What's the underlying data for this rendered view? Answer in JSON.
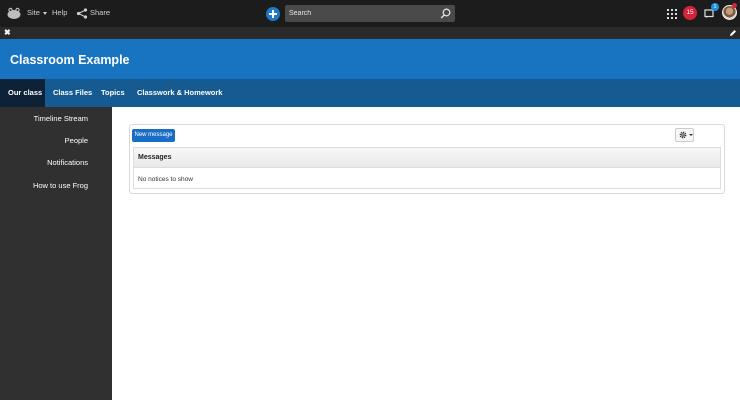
{
  "topbar": {
    "site_label": "Site",
    "help_label": "Help",
    "share_label": "Share",
    "search_placeholder": "Search",
    "notification_count": "15",
    "message_count": "1",
    "accent_color": "#1f78c8",
    "badge_color": "#d2233a"
  },
  "header": {
    "title": "Classroom Example",
    "color": "#1874c1"
  },
  "tabs": [
    {
      "label": "Our class",
      "active": true
    },
    {
      "label": "Class Files",
      "active": false
    },
    {
      "label": "Topics",
      "active": false
    },
    {
      "label": "Classwork & Homework",
      "active": false
    }
  ],
  "sidebar": {
    "items": [
      {
        "label": "Timeline Stream"
      },
      {
        "label": "People"
      },
      {
        "label": "Notifications"
      },
      {
        "label": "How to use Frog"
      }
    ]
  },
  "panel": {
    "new_message_label": "New message",
    "table_header": "Messages",
    "empty_text": "No notices to show"
  },
  "icons": [
    "logo-icon",
    "share-icon",
    "add-icon",
    "search-icon",
    "apps-grid-icon",
    "messages-icon",
    "close-icon",
    "edit-icon",
    "gear-icon",
    "chevron-down-icon"
  ]
}
